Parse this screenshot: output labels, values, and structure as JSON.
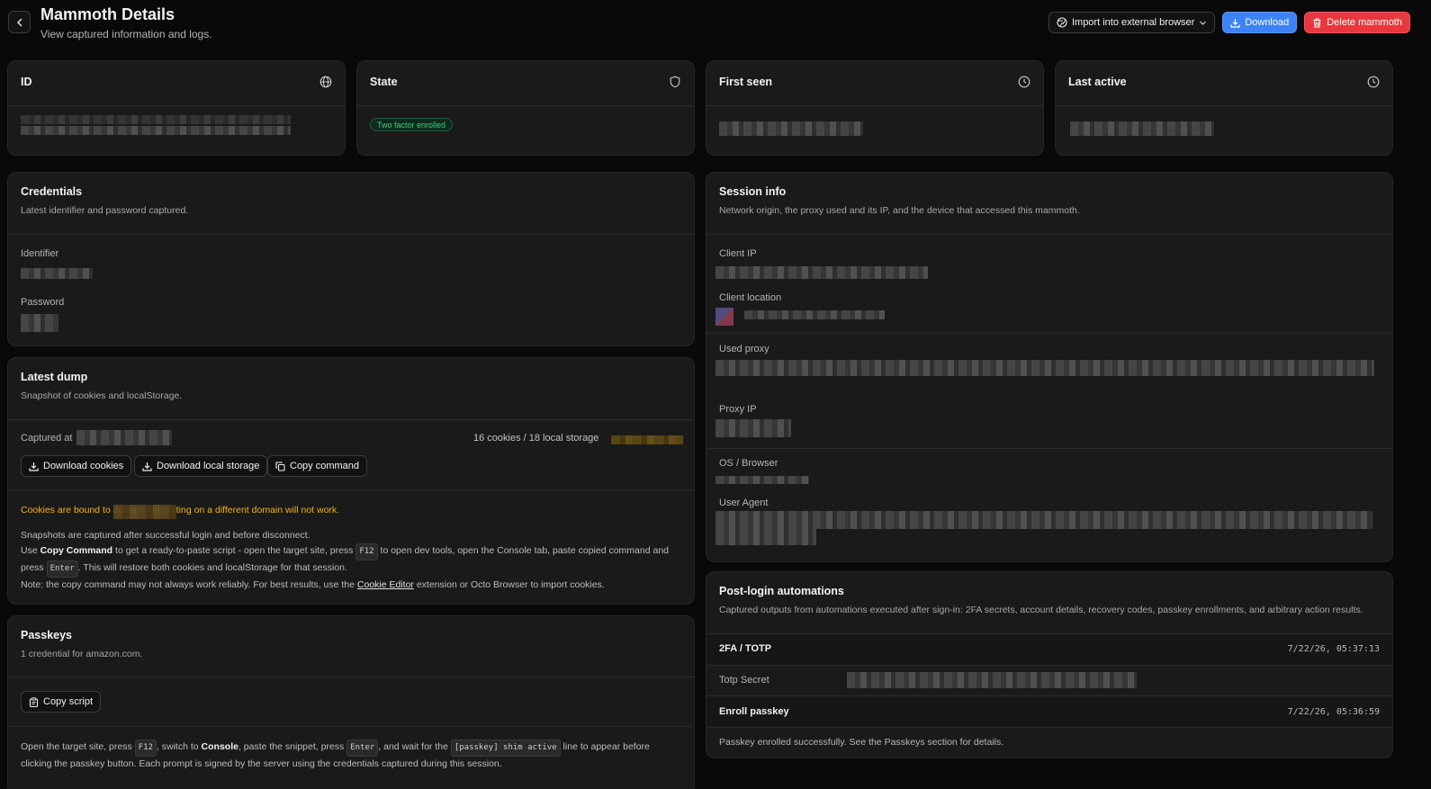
{
  "header": {
    "title": "Mammoth Details",
    "subtitle": "View captured information and logs.",
    "import_label": "Import into external browser",
    "download_label": "Download",
    "delete_label": "Delete mammoth"
  },
  "stats": {
    "id_title": "ID",
    "state_title": "State",
    "state_badge": "Two factor enrolled",
    "first_seen_title": "First seen",
    "last_active_title": "Last active"
  },
  "credentials": {
    "title": "Credentials",
    "desc": "Latest identifier and password captured.",
    "identifier_label": "Identifier",
    "password_label": "Password"
  },
  "dump": {
    "title": "Latest dump",
    "desc": "Snapshot of cookies and localStorage.",
    "captured_label": "Captured at",
    "counts": "16 cookies / 18 local storage",
    "btn_cookies": "Download cookies",
    "btn_local": "Download local storage",
    "btn_copy": "Copy command",
    "warn_pre": "Cookies are bound to",
    "warn_post": "domain - importing on a different domain will not work.",
    "p1": "Snapshots are captured after successful login and before disconnect.",
    "p2_a": "Use ",
    "p2_b": "Copy Command",
    "p2_c": " to get a ready-to-paste script - open the target site, press ",
    "p2_key1": "F12",
    "p2_d": " to open dev tools, open the Console tab, paste copied command and",
    "p3_a": "press ",
    "p3_key": "Enter",
    "p3_b": ". This will restore both cookies and localStorage for that session.",
    "p4_a": "Note: the copy command may not always work reliably. For best results, use the ",
    "p4_link": "Cookie Editor",
    "p4_b": " extension or Octo Browser to import cookies."
  },
  "passkeys": {
    "title": "Passkeys",
    "desc": "1 credential for amazon.com.",
    "btn_copy": "Copy script",
    "i_a": "Open the target site, press ",
    "i_k1": "F12",
    "i_b": ", switch to ",
    "i_bold": "Console",
    "i_c": ", paste the snippet, press ",
    "i_k2": "Enter",
    "i_d": ", and wait for the ",
    "i_k3": "[passkey] shim active",
    "i_e": " line to appear before",
    "i_line2": "clicking the passkey button. Each prompt is signed by the server using the credentials captured during this session."
  },
  "session": {
    "title": "Session info",
    "desc": "Network origin, the proxy used and its IP, and the device that accessed this mammoth.",
    "client_ip": "Client IP",
    "client_location": "Client location",
    "used_proxy": "Used proxy",
    "proxy_ip": "Proxy IP",
    "os_browser": "OS / Browser",
    "user_agent": "User Agent"
  },
  "automations": {
    "title": "Post-login automations",
    "desc": "Captured outputs from automations executed after sign-in: 2FA secrets, account details, recovery codes, passkey enrollments, and arbitrary action results.",
    "rows": [
      {
        "name": "2FA / TOTP",
        "time": "7/22/26, 05:37:13",
        "field": "Totp Secret"
      },
      {
        "name": "Enroll passkey",
        "time": "7/22/26, 05:36:59",
        "message": "Passkey enrolled successfully. See the Passkeys section for details."
      }
    ]
  },
  "colors": {
    "accent_blue": "#3d82f6",
    "danger_red": "#e9373d",
    "success_green": "#35d07f",
    "warning": "#f2b21c"
  }
}
